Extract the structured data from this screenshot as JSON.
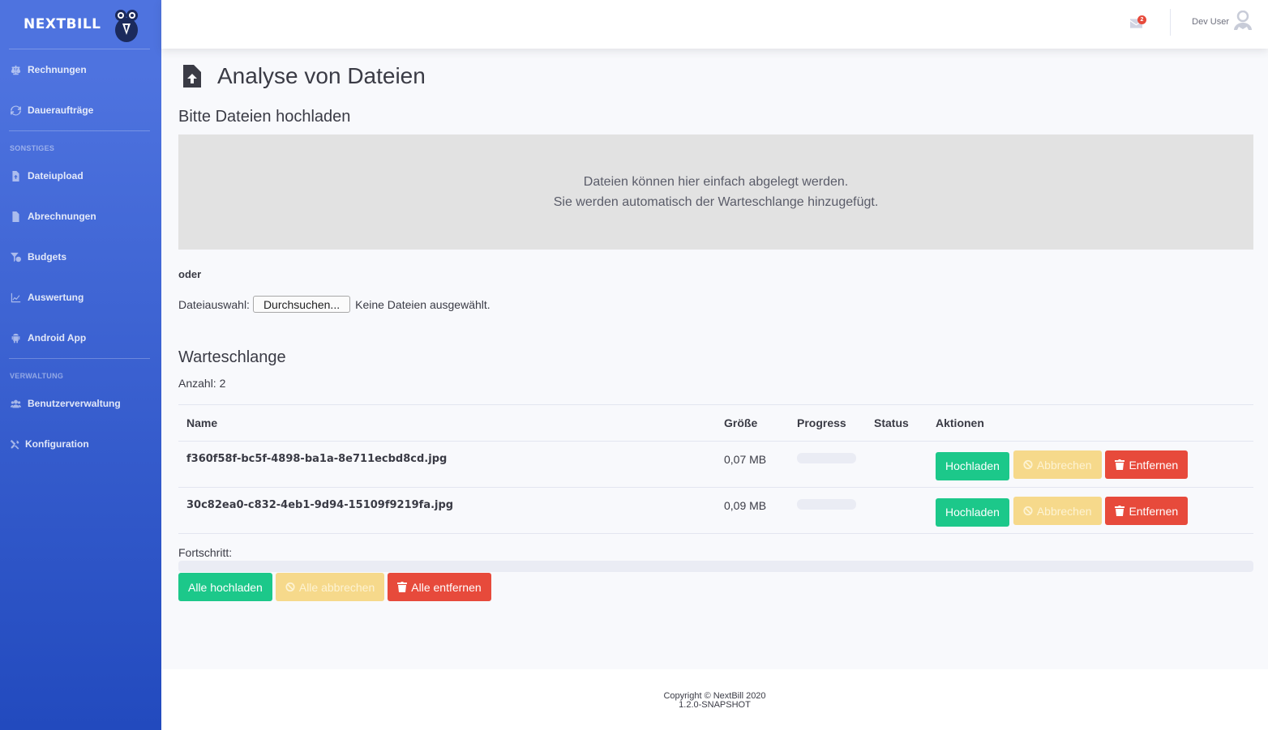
{
  "brand": {
    "name_bold": "NEXT",
    "name_rest": "BILL"
  },
  "sidebar": {
    "items_top": [
      {
        "label": "Rechnungen",
        "icon": "balance-scale-icon"
      },
      {
        "label": "Daueraufträge",
        "icon": "sync-icon"
      }
    ],
    "heading_sonstiges": "SONSTIGES",
    "items_sonstiges": [
      {
        "label": "Dateiupload",
        "icon": "file-upload-icon"
      },
      {
        "label": "Abrechnungen",
        "icon": "file-invoice-icon"
      },
      {
        "label": "Budgets",
        "icon": "funnel-dollar-icon"
      },
      {
        "label": "Auswertung",
        "icon": "chart-line-icon"
      },
      {
        "label": "Android App",
        "icon": "android-icon"
      }
    ],
    "heading_verwaltung": "VERWALTUNG",
    "items_verwaltung": [
      {
        "label": "Benutzerverwaltung",
        "icon": "users-icon"
      },
      {
        "label": "Konfiguration",
        "icon": "tools-icon"
      }
    ]
  },
  "topbar": {
    "mail_count": "2",
    "user_name": "Dev User"
  },
  "page": {
    "title": "Analyse von Dateien",
    "upload_heading": "Bitte Dateien hochladen",
    "dropzone_line1": "Dateien können hier einfach abgelegt werden.",
    "dropzone_line2": "Sie werden automatisch der Warteschlange hinzugefügt.",
    "oder": "oder",
    "file_select_label": "Dateiauswahl:",
    "browse_button": "Durchsuchen...",
    "no_files": "Keine Dateien ausgewählt.",
    "queue_heading": "Warteschlange",
    "count_text": "Anzahl: 2"
  },
  "table": {
    "headers": [
      "Name",
      "Größe",
      "Progress",
      "Status",
      "Aktionen"
    ],
    "rows": [
      {
        "name": "f360f58f-bc5f-4898-ba1a-8e711ecbd8cd.jpg",
        "size": "0,07 MB",
        "progress": 0,
        "status": ""
      },
      {
        "name": "30c82ea0-c832-4eb1-9d94-15109f9219fa.jpg",
        "size": "0,09 MB",
        "progress": 0,
        "status": ""
      }
    ],
    "btn_upload": "Hochladen",
    "btn_cancel": "Abbrechen",
    "btn_remove": "Entfernen"
  },
  "overall": {
    "label": "Fortschritt:",
    "progress": 0,
    "btn_upload_all": "Alle hochladen",
    "btn_cancel_all": "Alle abbrechen",
    "btn_remove_all": "Alle entfernen"
  },
  "footer": {
    "copyright": "Copyright © NextBill 2020",
    "version": "1.2.0-SNAPSHOT"
  },
  "colors": {
    "sidebar_top": "#4e73df",
    "sidebar_bottom": "#224abe",
    "success": "#1cc88a",
    "warning": "#f6c23e",
    "danger": "#e74a3b"
  }
}
